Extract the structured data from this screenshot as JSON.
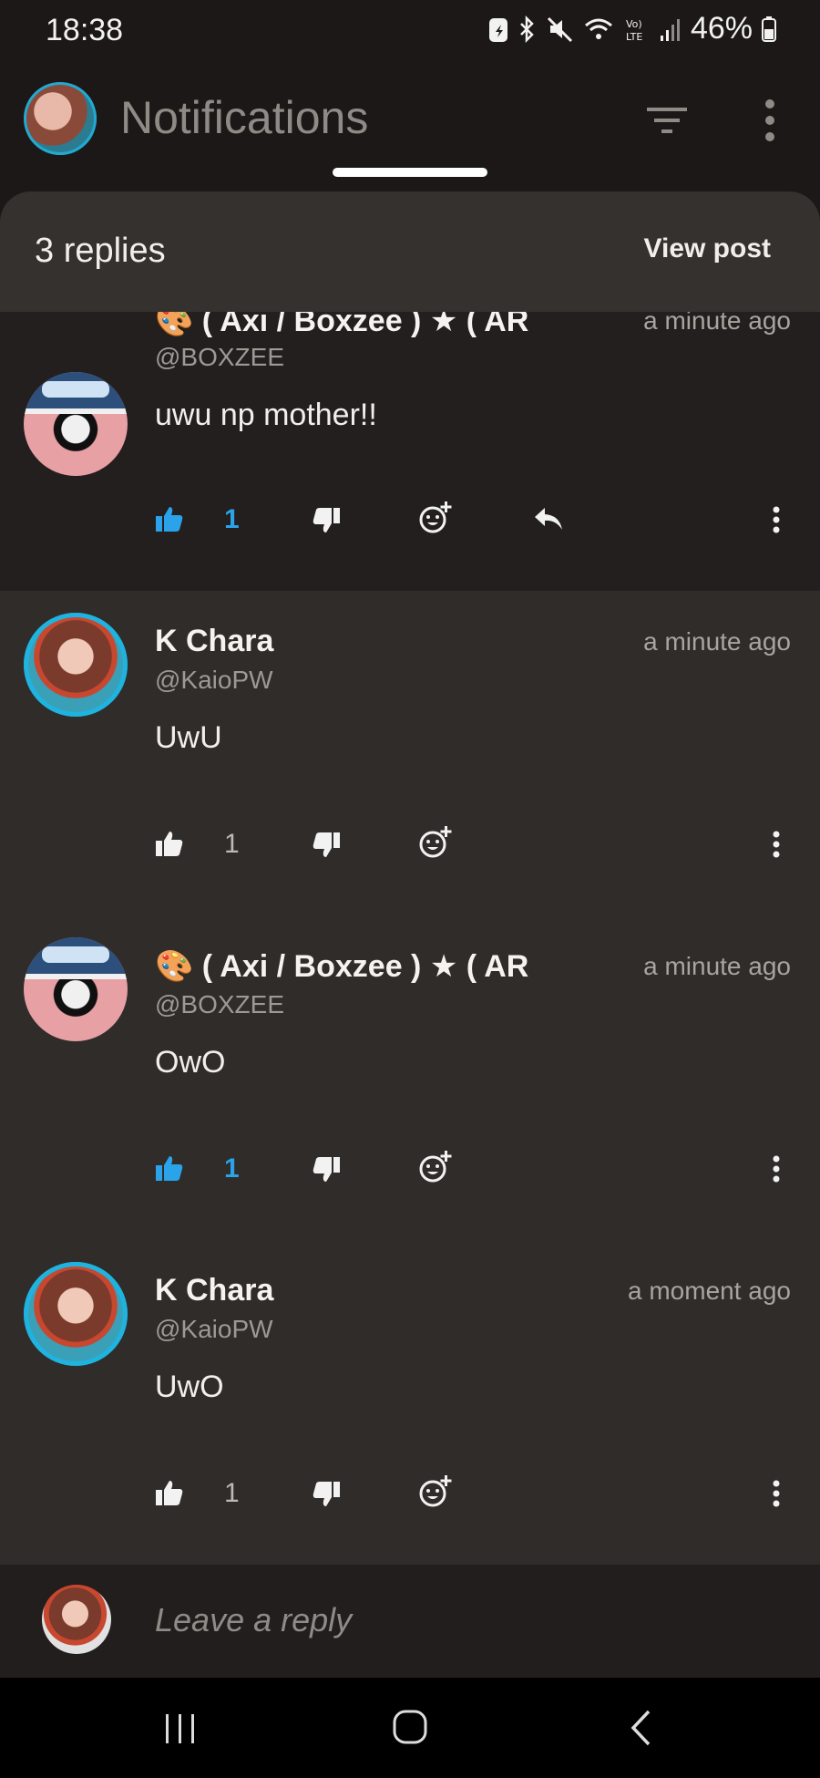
{
  "status_bar": {
    "time": "18:38",
    "battery": "46%"
  },
  "app_bar": {
    "title": "Notifications"
  },
  "sheet": {
    "title": "3 replies",
    "view_post_label": "View post"
  },
  "replies": [
    {
      "name": "( Axi / Boxzee ) ★ ( AR",
      "handle": "@BOXZEE",
      "time": "a minute ago",
      "text": "uwu np mother!!",
      "likes": "1",
      "liked": true
    },
    {
      "name": "K Chara",
      "handle": "@KaioPW",
      "time": "a minute ago",
      "text": "UwU",
      "likes": "1",
      "liked": false
    },
    {
      "name": "( Axi / Boxzee ) ★ ( AR",
      "handle": "@BOXZEE",
      "time": "a minute ago",
      "text": "OwO",
      "likes": "1",
      "liked": true
    },
    {
      "name": "K Chara",
      "handle": "@KaioPW",
      "time": "a moment ago",
      "text": "UwO",
      "likes": "1",
      "liked": false
    }
  ],
  "reply_bar": {
    "placeholder": "Leave a reply"
  },
  "colors": {
    "accent_blue": "#2aa3ea",
    "background": "#1b1817",
    "sheet": "#2f2c29"
  }
}
